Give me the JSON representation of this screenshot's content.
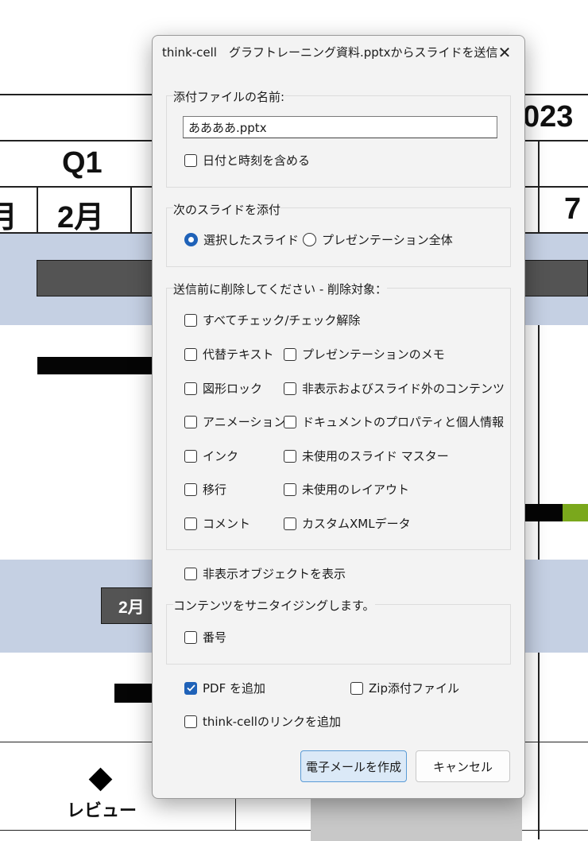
{
  "background": {
    "year_text": "023",
    "quarter_label": "Q1",
    "month_labels": [
      "月",
      "2月",
      "7"
    ],
    "bar_label": "2月",
    "milestone_label": "レビュー"
  },
  "dialog": {
    "title": "think-cell　グラフトレーニング資料.pptxからスライドを送信",
    "filename_group": {
      "label": "添付ファイルの名前:",
      "filename_value": "ああああ.pptx",
      "include_datetime": {
        "label": "日付と時刻を含める",
        "checked": false
      }
    },
    "slides_group": {
      "label": "次のスライドを添付",
      "options": [
        {
          "label": "選択したスライド",
          "selected": true
        },
        {
          "label": "プレゼンテーション全体",
          "selected": false
        }
      ]
    },
    "remove_group": {
      "label": "送信前に削除してください - 削除対象：",
      "check_all": {
        "label": "すべてチェック/チェック解除",
        "checked": false
      },
      "left_items": [
        {
          "label": "代替テキスト",
          "checked": false
        },
        {
          "label": "図形ロック",
          "checked": false
        },
        {
          "label": "アニメーション",
          "checked": false
        },
        {
          "label": "インク",
          "checked": false
        },
        {
          "label": "移行",
          "checked": false
        },
        {
          "label": "コメント",
          "checked": false
        }
      ],
      "right_items": [
        {
          "label": "プレゼンテーションのメモ",
          "checked": false
        },
        {
          "label": "非表示およびスライド外のコンテンツ",
          "checked": false
        },
        {
          "label": "ドキュメントのプロパティと個人情報",
          "checked": false
        },
        {
          "label": "未使用のスライド マスター",
          "checked": false
        },
        {
          "label": "未使用のレイアウト",
          "checked": false
        },
        {
          "label": "カスタムXMLデータ",
          "checked": false
        }
      ]
    },
    "show_hidden": {
      "label": "非表示オブジェクトを表示",
      "checked": false
    },
    "sanitize_group": {
      "label": "コンテンツをサニタイジングします。",
      "number": {
        "label": "番号",
        "checked": false
      }
    },
    "add_pdf": {
      "label": "PDF を追加",
      "checked": true
    },
    "zip_attach": {
      "label": "Zip添付ファイル",
      "checked": false
    },
    "add_link": {
      "label": "think-cellのリンクを追加",
      "checked": false
    },
    "buttons": {
      "create_email": "電子メールを作成",
      "cancel": "キャンセル"
    },
    "accent_color": "#1f62b8"
  }
}
